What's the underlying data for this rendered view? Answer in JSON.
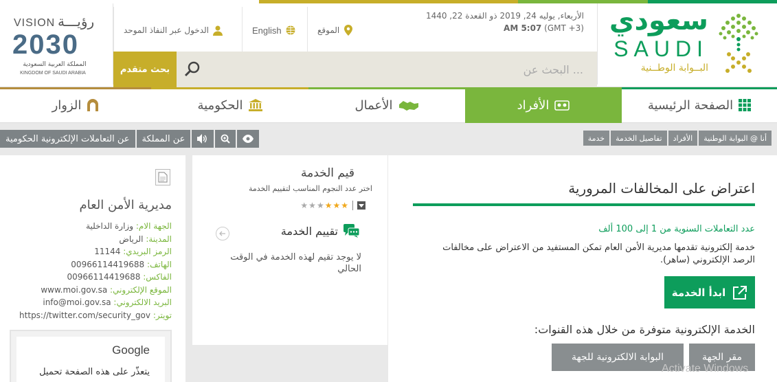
{
  "brand": {
    "logo_arabic": "سعودي",
    "logo_latin": "SAUDI",
    "logo_tagline": "البــوابة الوطــنية",
    "vision_arabic": "رؤيـــة",
    "vision_latin": "VISION",
    "vision_year": "2030",
    "vision_country_ar": "المملكة العربية السعودية",
    "vision_country_en": "KINGDOM OF SAUDI ARABIA"
  },
  "header": {
    "date_line1": "الأربعاء, يوليه 24, 2019 ذو القعدة 22, 1440",
    "time": "AM 5:07",
    "timezone": "(GMT +3)",
    "location_label": "الموقع",
    "language_label": "English",
    "login_label": "الدخول عبر النفاذ الموحد"
  },
  "search": {
    "placeholder": "البحث عن ...",
    "advanced_label": "بحث متقدم"
  },
  "nav": {
    "tabs": [
      {
        "label": "الصفحة الرئيسية",
        "accent": "#0d9d5b"
      },
      {
        "label": "الأفراد",
        "accent": "#7ab63d"
      },
      {
        "label": "الأعمال",
        "accent": "#7ab63d"
      },
      {
        "label": "الحكومية",
        "accent": "#c7ae2a"
      },
      {
        "label": "الزوار",
        "accent": "#b58d3d"
      }
    ]
  },
  "toolbar": {
    "gov_transactions": "عن التعاملات الإلكترونية الحكومية",
    "about_kingdom": "عن المملكة"
  },
  "breadcrumb": {
    "items": [
      "أنا @ البوابة الوطنية",
      "الأفراد",
      "تفاصيل الخدمة",
      "خدمة"
    ]
  },
  "service": {
    "title": "اعتراض على المخالفات المرورية",
    "annual_count": "عدد التعاملات السنوية من 1 إلى 100 ألف",
    "description": "خدمة إلكترونية تقدمها مديرية الأمن العام تمكن المستفيد من الاعتراض على مخالفات الرصد الإلكتروني (ساهر).",
    "start_label": "ابدأ الخدمة",
    "channels_heading": "الخدمة الإلكترونية متوفرة من خلال هذه القنوات:",
    "channel_1": "مقر الجهة",
    "channel_2": "البوابة الالكترونية للجهة"
  },
  "rating": {
    "heading": "قيم الخدمة",
    "subtitle": "اختر عدد النجوم المناسب لتقييم الخدمة",
    "stars_filled": 3,
    "stars_total": 6,
    "evaluation_heading": "تقييم الخدمة",
    "no_rating": "لا يوجد تقيم لهذه الخدمة في الوقت الحالي"
  },
  "agency": {
    "name": "مديرية الأمن العام",
    "fields": [
      {
        "label": "الجهة الام:",
        "value": "وزارة الداخلية"
      },
      {
        "label": "المدينة:",
        "value": "الرياض"
      },
      {
        "label": "الرمز البريدي:",
        "value": "11144"
      },
      {
        "label": "الهاتف:",
        "value": "00966114419688"
      },
      {
        "label": "الفاكس:",
        "value": "00966114419688"
      },
      {
        "label": "الموقع الإلكتروني:",
        "value": "www.moi.gov.sa"
      },
      {
        "label": "البريد الالكتروني:",
        "value": "info@moi.gov.sa"
      },
      {
        "label": "تويتر:",
        "value": "https://twitter.com/security_gov"
      }
    ],
    "google_title": "Google",
    "google_text": "يتعذّر على هذه الصفحة تحميل"
  },
  "watermark": "Activate Windows",
  "colors": {
    "green": "#0d9d5b",
    "lime": "#7ab63d",
    "gold": "#c7ae2a",
    "gray_button": "#7d8386"
  }
}
